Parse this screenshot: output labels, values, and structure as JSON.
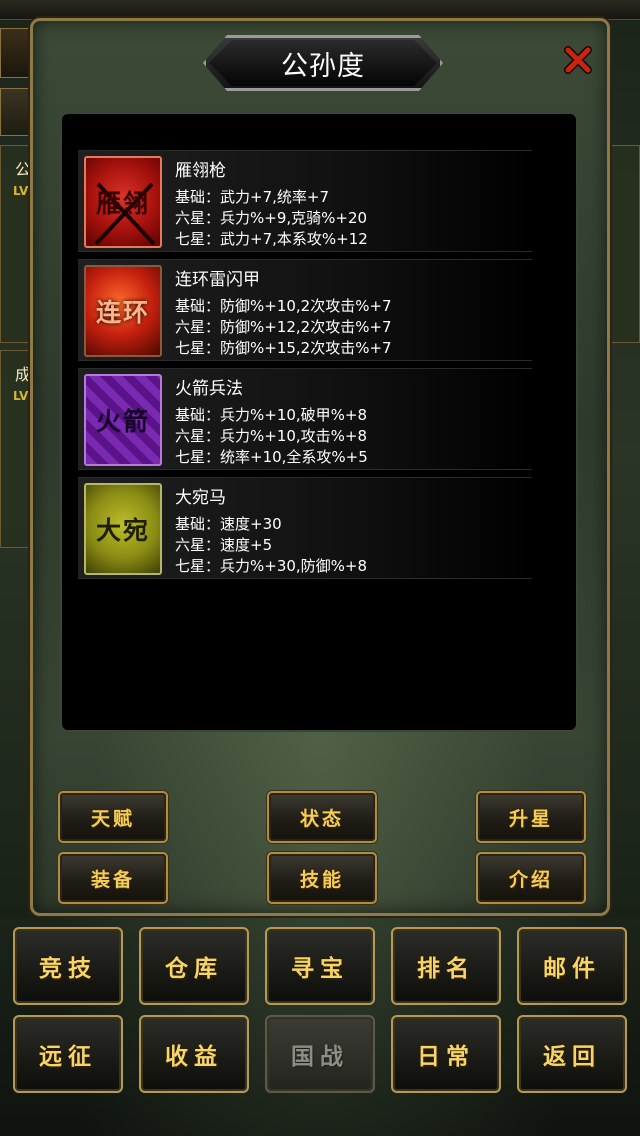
{
  "dialog": {
    "title": "公孙度"
  },
  "equipment": [
    {
      "name": "雁翎枪",
      "icon_text": "雁翎",
      "icon_color": "#a5110c",
      "lines": [
        "基础：武力+7,统率+7",
        "六星：兵力%+9,克骑%+20",
        "七星：武力+7,本系攻%+12"
      ]
    },
    {
      "name": "连环雷闪甲",
      "icon_text": "连环",
      "icon_color": "#c4200e",
      "lines": [
        "基础：防御%+10,2次攻击%+7",
        "六星：防御%+12,2次攻击%+7",
        "七星：防御%+15,2次攻击%+7"
      ]
    },
    {
      "name": "火箭兵法",
      "icon_text": "火箭",
      "icon_color": "#6a1d9c",
      "lines": [
        "基础：兵力%+10,破甲%+8",
        "六星：兵力%+10,攻击%+8",
        "七星：统率+10,全系攻%+5"
      ]
    },
    {
      "name": "大宛马",
      "icon_text": "大宛",
      "icon_color": "#8a8b14",
      "lines": [
        "基础：速度+30",
        "六星：速度+5",
        "七星：兵力%+30,防御%+8"
      ]
    }
  ],
  "actions": {
    "talent": "天赋",
    "status": "状态",
    "star_up": "升星",
    "equip": "装备",
    "skill": "技能",
    "intro": "介绍"
  },
  "menu": {
    "arena": "竞技",
    "storage": "仓库",
    "treasure": "寻宝",
    "ranking": "排名",
    "mail": "邮件",
    "expedition": "远征",
    "income": "收益",
    "nation_war": "国战",
    "daily": "日常",
    "back": "返回"
  },
  "background": {
    "card1_name": "公",
    "card2_name": "成",
    "level_tag": "LV"
  }
}
